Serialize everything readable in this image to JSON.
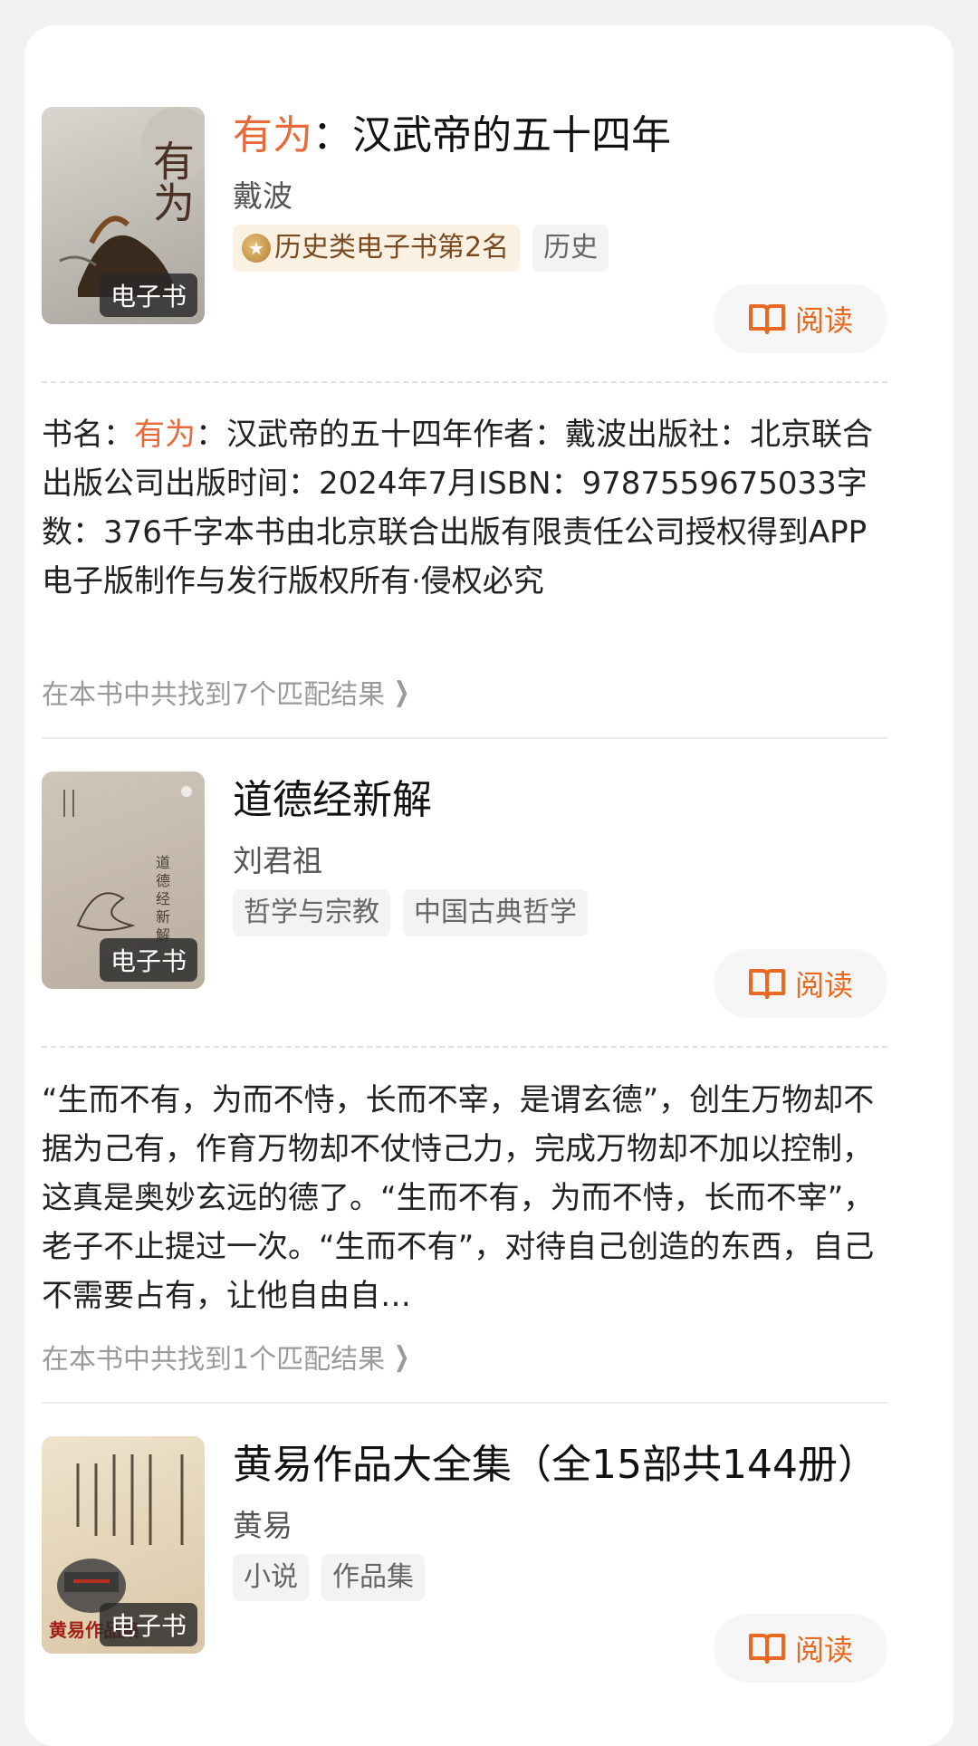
{
  "books": [
    {
      "cover_label": "电子书",
      "cover_text": "有为",
      "title_highlight": "有为",
      "title_rest": "：汉武帝的五十四年",
      "author": "戴波",
      "rank_tag": "历史类电子书第2名",
      "tags": [
        "历史"
      ],
      "read_label": "阅读",
      "desc_label": "书名：",
      "desc_highlight": "有为",
      "desc_rest": "：汉武帝的五十四年作者：戴波出版社：北京联合出版公司出版时间：2024年7月ISBN：9787559675033字数：376千字本书由北京联合出版有限责任公司授权得到APP电子版制作与发行版权所有·侵权必究",
      "match_text": "在本书中共找到7个匹配结果"
    },
    {
      "cover_label": "电子书",
      "cover_text": "道德经新解",
      "title": "道德经新解",
      "author": "刘君祖",
      "tags": [
        "哲学与宗教",
        "中国古典哲学"
      ],
      "read_label": "阅读",
      "desc": "“生而不有，为而不恃，长而不宰，是谓玄德”，创生万物却不据为己有，作育万物却不仗恃己力，完成万物却不加以控制，这真是奥妙玄远的德了。“生而不有，为而不恃，长而不宰”，老子不止提过一次。“生而不有”，对待自己创造的东西，自己不需要占有，让他自由自…",
      "match_text": "在本书中共找到1个匹配结果"
    },
    {
      "cover_label": "电子书",
      "cover_text": "黄易作品集",
      "title": "黄易作品大全集（全15部共144册）",
      "author": "黄易",
      "tags": [
        "小说",
        "作品集"
      ],
      "read_label": "阅读"
    }
  ],
  "colors": {
    "accent": "#e8693a",
    "button_text": "#e8691f"
  },
  "icons": {
    "read": "open-book-icon",
    "chevron": "chevron-right-icon",
    "medal": "medal-icon"
  }
}
